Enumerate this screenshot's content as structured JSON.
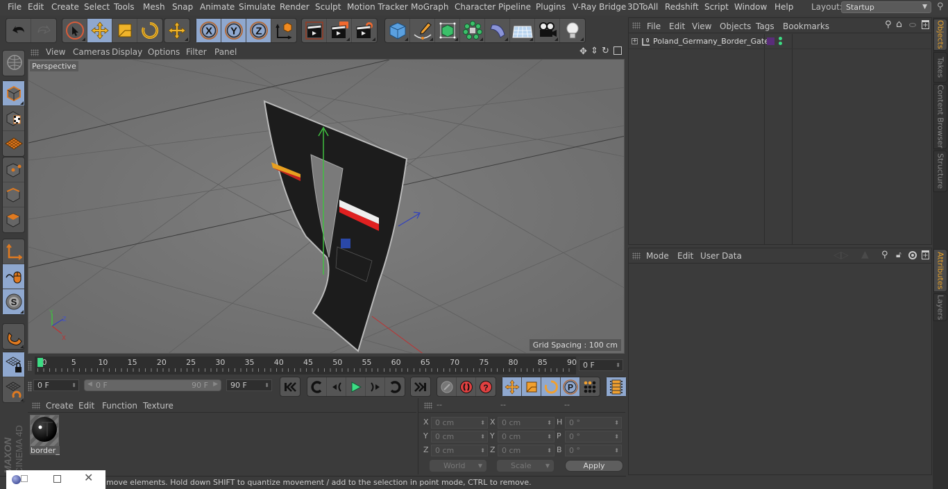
{
  "menubar": {
    "items": [
      "File",
      "Edit",
      "Create",
      "Select",
      "Tools",
      "Mesh",
      "Snap",
      "Animate",
      "Simulate",
      "Render",
      "Sculpt",
      "Motion Tracker",
      "MoGraph",
      "Character",
      "Pipeline",
      "Plugins",
      "V-Ray Bridge",
      "3DToAll",
      "Redshift",
      "Script",
      "Window",
      "Help"
    ],
    "layout_label": "Layout:",
    "layout_value": "Startup"
  },
  "toolbar": {
    "groups": [
      {
        "buttons": [
          {
            "icon": "undo-icon",
            "active": false
          },
          {
            "icon": "redo-icon",
            "active": false
          }
        ]
      },
      {
        "buttons": [
          {
            "icon": "live-selection-icon",
            "active": false
          },
          {
            "icon": "move-icon",
            "active": true
          },
          {
            "icon": "scale-icon",
            "active": false
          },
          {
            "icon": "rotate-icon",
            "active": false
          }
        ]
      },
      {
        "buttons": [
          {
            "icon": "recent-tool-icon",
            "active": false
          }
        ]
      },
      {
        "buttons": [
          {
            "icon": "x-axis-icon",
            "label": "X",
            "active": true
          },
          {
            "icon": "y-axis-icon",
            "label": "Y",
            "active": true
          },
          {
            "icon": "z-axis-icon",
            "label": "Z",
            "active": true
          },
          {
            "icon": "coordinate-system-icon",
            "active": false
          }
        ]
      },
      {
        "buttons": [
          {
            "icon": "render-view-icon",
            "active": false
          },
          {
            "icon": "render-to-picture-viewer-icon",
            "active": false
          },
          {
            "icon": "render-settings-icon",
            "active": false
          }
        ]
      },
      {
        "buttons": [
          {
            "icon": "cube-icon",
            "active": false
          },
          {
            "icon": "pen-spline-icon",
            "active": false
          },
          {
            "icon": "subdivision-surface-icon",
            "active": false
          },
          {
            "icon": "cloner-icon",
            "active": false
          },
          {
            "icon": "bend-deformer-icon",
            "active": false
          },
          {
            "icon": "floor-icon",
            "active": false
          },
          {
            "icon": "camera-icon",
            "active": false
          },
          {
            "icon": "light-icon",
            "active": false
          }
        ]
      }
    ]
  },
  "left_tools": [
    {
      "icon": "make-editable-icon",
      "active": false
    },
    {
      "icon": "model-mode-icon",
      "active": true
    },
    {
      "icon": "texture-mode-icon",
      "active": false
    },
    {
      "icon": "workplane-mode-icon",
      "active": false
    },
    {
      "icon": "points-mode-icon",
      "active": false
    },
    {
      "icon": "edges-mode-icon",
      "active": false
    },
    {
      "icon": "polygons-mode-icon",
      "active": false
    },
    {
      "icon": "axis-mode-icon",
      "active": false
    },
    {
      "icon": "tweak-mode-icon",
      "active": true
    },
    {
      "icon": "solo-mode-icon",
      "active": true
    },
    {
      "icon": "snap-magnet-icon",
      "active": false
    },
    {
      "icon": "lock-workplane-icon",
      "active": true
    },
    {
      "icon": "planar-workplane-icon",
      "active": false
    }
  ],
  "brand": {
    "maker": "MAXON",
    "product": "CINEMA 4D"
  },
  "viewport": {
    "menu": [
      "View",
      "Cameras",
      "Display",
      "Options",
      "Filter",
      "Panel"
    ],
    "camera_label": "Perspective",
    "grid_spacing": "Grid Spacing : 100 cm",
    "axis_labels": {
      "x": "X",
      "y": "Y",
      "z": "Z"
    },
    "nav_icons": [
      "pan-icon",
      "dolly-icon",
      "orbit-icon",
      "maximize-view-icon"
    ]
  },
  "timeline": {
    "ticks": [
      0,
      5,
      10,
      15,
      20,
      25,
      30,
      35,
      40,
      45,
      50,
      55,
      60,
      65,
      70,
      75,
      80,
      85,
      90
    ],
    "min": 0,
    "max": 90,
    "current_frame": 0,
    "current_frame_field": "0 F"
  },
  "playback": {
    "start_field": "0 F",
    "range_start": "0 F",
    "range_end": "90 F",
    "end_field": "90 F",
    "transport_buttons": [
      "go-to-start-icon",
      "go-to-previous-key-icon",
      "step-back-icon",
      "play-forward-icon",
      "step-forward-icon",
      "go-to-next-key-icon",
      "go-to-end-icon"
    ],
    "key_buttons": [
      "record-key-disabled-icon",
      "autokey-icon",
      "keyframe-selection-icon"
    ],
    "key_param_buttons": [
      {
        "icon": "key-position-icon",
        "active": true
      },
      {
        "icon": "key-scale-icon",
        "active": true
      },
      {
        "icon": "key-rotation-icon",
        "active": true
      },
      {
        "icon": "key-parameter-icon",
        "label": "P",
        "active": true
      },
      {
        "icon": "key-point-level-icon",
        "active": false
      }
    ],
    "timeline_window_icon": "timeline-window-icon"
  },
  "material_manager": {
    "menu": [
      "Create",
      "Edit",
      "Function",
      "Texture"
    ],
    "materials": [
      {
        "name": "border_"
      }
    ]
  },
  "coordinates": {
    "headers": [
      "--",
      "--",
      "--"
    ],
    "rows": [
      {
        "pos_label": "X",
        "pos": "0 cm",
        "size_label": "X",
        "size": "0 cm",
        "rot_label": "H",
        "rot": "0 °"
      },
      {
        "pos_label": "Y",
        "pos": "0 cm",
        "size_label": "Y",
        "size": "0 cm",
        "rot_label": "P",
        "rot": "0 °"
      },
      {
        "pos_label": "Z",
        "pos": "0 cm",
        "size_label": "Z",
        "size": "0 cm",
        "rot_label": "B",
        "rot": "0 °"
      }
    ],
    "space_dropdown": "World",
    "mode_dropdown": "Scale",
    "apply_label": "Apply"
  },
  "status": {
    "text": "move elements. Hold down SHIFT to quantize movement / add to the selection in point mode, CTRL to remove."
  },
  "object_manager": {
    "menu": [
      "File",
      "Edit",
      "View",
      "Objects",
      "Tags",
      "Bookmarks"
    ],
    "objects": [
      {
        "name": "Poland_Germany_Border_Gate",
        "type": "null",
        "layer_color": "#5a2d7a",
        "dot_color": "#3ddc84"
      }
    ]
  },
  "attribute_manager": {
    "menu": [
      "Mode",
      "Edit",
      "User Data"
    ]
  },
  "right_tabs": {
    "top": [
      {
        "label": "Objects",
        "active": true
      },
      {
        "label": "Takes",
        "active": false
      },
      {
        "label": "Content Browser",
        "active": false
      },
      {
        "label": "Structure",
        "active": false
      }
    ],
    "bottom": [
      {
        "label": "Attributes",
        "active": true
      },
      {
        "label": "Layers",
        "active": false
      }
    ]
  },
  "colors": {
    "accent_blue": "#8fa8cf",
    "tab_active": "#e8a22a",
    "frame_marker": "#3ddc84"
  }
}
